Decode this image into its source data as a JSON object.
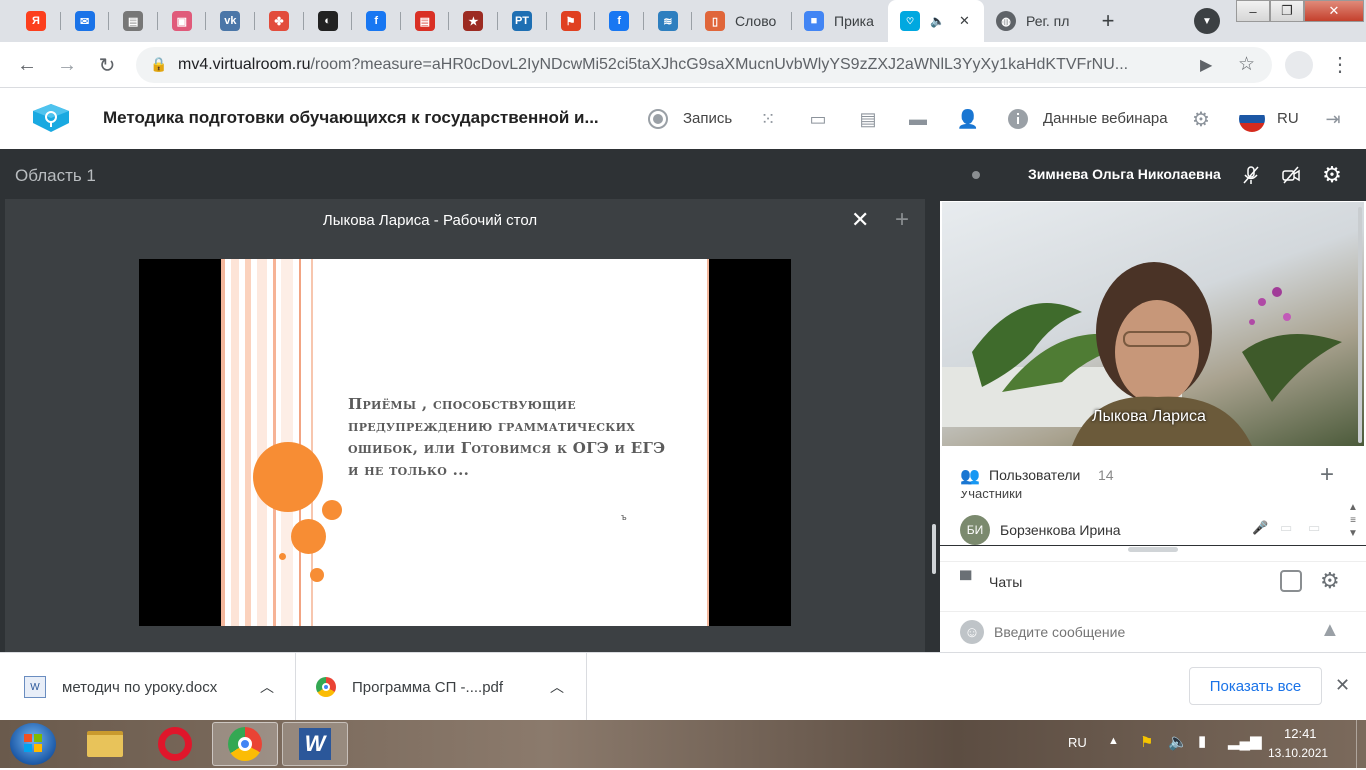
{
  "browser": {
    "tabs": [
      {
        "icon": "yandex-icon",
        "glyph": "Я",
        "color": "#fc3f1d"
      },
      {
        "icon": "mail-icon",
        "glyph": "✉",
        "color": "#1a73e8"
      },
      {
        "icon": "document-icon",
        "glyph": "▤",
        "color": "#777777"
      },
      {
        "icon": "photo-icon",
        "glyph": "▣",
        "color": "#e05a7a"
      },
      {
        "icon": "vk-icon",
        "glyph": "vk",
        "color": "#4a76a8"
      },
      {
        "icon": "colorful-dots-icon",
        "glyph": "✤",
        "color": "#e24c3c"
      },
      {
        "icon": "dark-app-icon",
        "glyph": "◐",
        "color": "#222222"
      },
      {
        "icon": "facebook-icon",
        "glyph": "f",
        "color": "#1877f2"
      },
      {
        "icon": "red-page-icon",
        "glyph": "▤",
        "color": "#d93025"
      },
      {
        "icon": "star-emblem-icon",
        "glyph": "★",
        "color": "#9c2b22"
      },
      {
        "icon": "pt-icon",
        "glyph": "РТ",
        "color": "#1e6fb3"
      },
      {
        "icon": "flag-news-icon",
        "glyph": "⚑",
        "color": "#e04020"
      },
      {
        "icon": "facebook-icon",
        "glyph": "f",
        "color": "#1877f2"
      },
      {
        "icon": "wave-icon",
        "glyph": "≋",
        "color": "#2e7fbf"
      }
    ],
    "wide_tabs": [
      {
        "label": "Слово",
        "icon": "book-icon",
        "color": "#e0663a"
      },
      {
        "label": "Прика",
        "icon": "cube-icon",
        "color": "#4285f4"
      },
      {
        "label": "",
        "icon": "virtualroom-icon",
        "color": "#00a8e0",
        "audio": "🔈",
        "active": true
      },
      {
        "label": "Рег. пл",
        "icon": "globe-icon",
        "color": "#5f6368"
      }
    ],
    "new_tab": "+",
    "url_host": "mv4.virtualroom.ru",
    "url_path": "/room?measure=aHR0cDovL2IyNDcwMi52ci5taXJhcG9saXMucnUvbWlyYS9zZXJ2aWNlL3YyXy1kaHdKTVFrNU..."
  },
  "app": {
    "title": "Методика подготовки обучающихся к государственной и...",
    "record_label": "Запись",
    "webinar_data_label": "Данные вебинара",
    "language": "RU"
  },
  "main": {
    "area_title": "Область 1",
    "panel_title": "Лыкова Лариса - Рабочий стол",
    "slide_text": "Приёмы , способствующие предупреждению грамматических ошибок, или Готовимся к ОГЭ и  ЕГЭ и не только ...",
    "slide_mark": "ъ"
  },
  "side": {
    "presenter_name": "Зимнева Ольга Николаевна",
    "video_label": "Лыкова Лариса",
    "users_label": "Пользователи",
    "users_count": "14",
    "users_section_partial": "Участники",
    "user_initials": "БИ",
    "user_name": "Борзенкова Ирина",
    "chats_label": "Чаты",
    "message_placeholder": "Введите сообщение"
  },
  "downloads": {
    "items": [
      {
        "name": "методич по уроку.docx",
        "icon": "word-doc-icon"
      },
      {
        "name": "Программа СП -....pdf",
        "icon": "chrome-icon"
      }
    ],
    "show_all": "Показать все"
  },
  "taskbar": {
    "lang": "RU",
    "time": "12:41",
    "date": "13.10.2021"
  }
}
